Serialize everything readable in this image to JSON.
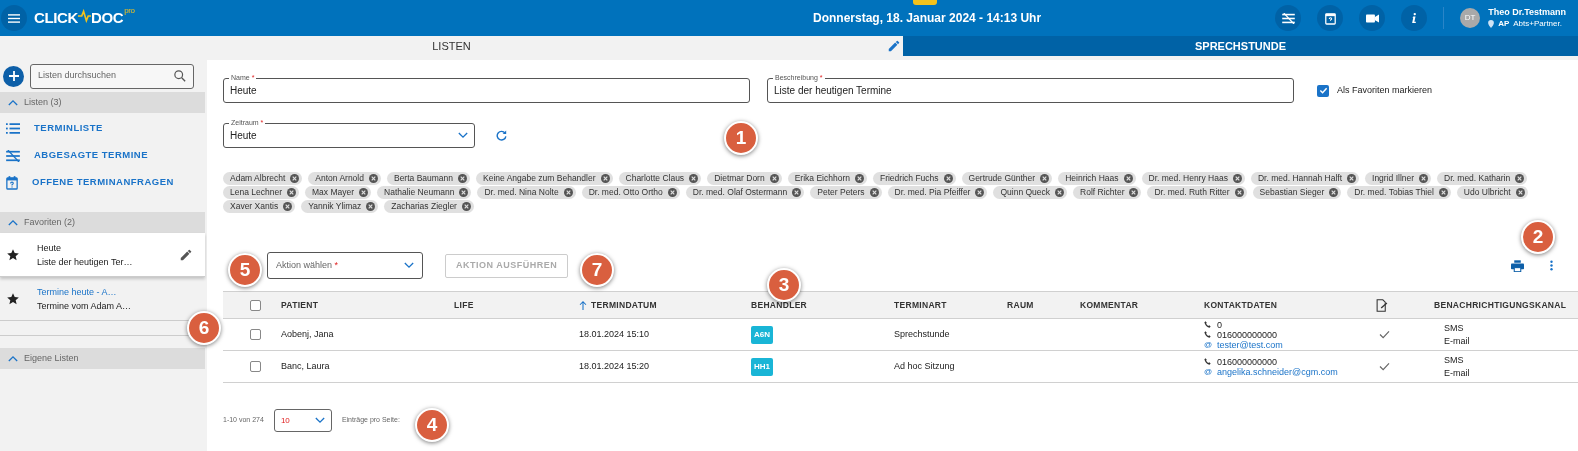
{
  "header": {
    "logo_left": "CLICK",
    "logo_right": "DOC",
    "logo_sup": "pro",
    "date": "Donnerstag, 18. Januar 2024 - 14:13 Uhr",
    "user_initials": "DT",
    "user_name": "Theo Dr.Testmann",
    "location": "AP",
    "practice": "Abts+Partner."
  },
  "tabs": [
    {
      "label": "LISTEN",
      "selected": false
    },
    {
      "label": "SPRECHSTUNDE",
      "selected": true
    }
  ],
  "sidebar": {
    "search_placeholder": "Listen durchsuchen",
    "sections": [
      {
        "title": "Listen (3)",
        "expanded": true,
        "kind": "links",
        "items": [
          {
            "label": "TERMINLISTE"
          },
          {
            "label": "ABGESAGTE TERMINE"
          },
          {
            "label": "OFFENE TERMINANFRAGEN"
          }
        ]
      },
      {
        "title": "Favoriten (2)",
        "expanded": true,
        "kind": "favorites",
        "items": [
          {
            "title": "Heute",
            "subtitle": "Liste der heutigen Ter…",
            "selected": true
          },
          {
            "title": "Termine heute - A…",
            "subtitle": "Termine vom Adam A…",
            "selected": false
          }
        ]
      },
      {
        "title": "Eigene Listen",
        "expanded": true,
        "kind": "links"
      }
    ]
  },
  "form": {
    "name": {
      "label": "Name",
      "required_mark": "*",
      "value": "Heute"
    },
    "description": {
      "label": "Beschreibung",
      "required_mark": "*",
      "value": "Liste der heutigen Termine"
    },
    "favorite": {
      "label": "Als Favoriten markieren",
      "checked": true
    },
    "period": {
      "label": "Zeitraum",
      "required_mark": "*",
      "value": "Heute"
    },
    "chip_rows": [
      [
        "Adam Albrecht",
        "Anton Arnold",
        "Berta Baumann",
        "Keine Angabe zum Behandler",
        "Charlotte Claus",
        "Dietmar Dorn",
        "Erika Eichhorn",
        "Friedrich Fuchs",
        "Gertrude Günther",
        "Heinrich Haas",
        "Dr. med. Henry Haas",
        "Dr. med. Hannah Halft",
        "Ingrid Illner",
        "Dr. med. Katharin"
      ],
      [
        "Lena Lechner",
        "Max Mayer",
        "Nathalie Neumann",
        "Dr. med. Nina Nolte",
        "Dr. med. Otto Ortho",
        "Dr. med. Olaf Ostermann",
        "Peter Peters",
        "Dr. med. Pia Pfeiffer",
        "Quinn Queck",
        "Rolf Richter",
        "Dr. med. Ruth Ritter",
        "Sebastian Sieger",
        "Dr. med. Tobias Thiel",
        "Udo Ulbricht"
      ],
      [
        "Xaver Xantis",
        "Yannik Ylimaz",
        "Zacharias Ziegler"
      ]
    ]
  },
  "action": {
    "placeholder": "Aktion wählen",
    "required_mark": "*",
    "button": "AKTION AUSFÜHREN",
    "disabled": true
  },
  "table": {
    "all_checked": false,
    "columns": [
      {
        "label": "PATIENT",
        "sorted": false
      },
      {
        "label": "LIFE",
        "sorted": false
      },
      {
        "label": "TERMINDATUM",
        "sorted": true
      },
      {
        "label": "BEHANDLER",
        "sorted": false
      },
      {
        "label": "TERMINART",
        "sorted": false
      },
      {
        "label": "RAUM",
        "sorted": false
      },
      {
        "label": "KOMMENTAR",
        "sorted": false
      },
      {
        "label": "KONTAKTDATEN",
        "sorted": false
      },
      {
        "kind": "icon"
      },
      {
        "label": "BENACHRICHTIGUNGSKANAL",
        "sorted": false
      }
    ],
    "rows": [
      {
        "checked": false,
        "patient": "Aobenj, Jana",
        "date": "18.01.2024 15:10",
        "practitioner": "A6N",
        "type": "Sprechstunde",
        "contacts": [
          {
            "kind": "phone",
            "value": "0"
          },
          {
            "kind": "phone",
            "value": "016000000000"
          },
          {
            "kind": "email",
            "symbol": "@",
            "value": "tester@test.com"
          }
        ],
        "confirmed": true,
        "channels": [
          "SMS",
          "E-mail"
        ]
      },
      {
        "checked": false,
        "patient": "Banc, Laura",
        "date": "18.01.2024 15:20",
        "practitioner": "HH1",
        "type": "Ad hoc Sitzung",
        "contacts": [
          {
            "kind": "phone",
            "value": "016000000000"
          },
          {
            "kind": "email",
            "symbol": "@",
            "value": "angelika.schneider@cgm.com"
          }
        ],
        "confirmed": true,
        "channels": [
          "SMS",
          "E-mail"
        ]
      }
    ]
  },
  "pagination": {
    "range": "1-10 von 274",
    "per_page": "10",
    "per_page_label": "Einträge pro Seite:"
  },
  "annotations": [
    "1",
    "2",
    "3",
    "4",
    "5",
    "6",
    "7"
  ]
}
